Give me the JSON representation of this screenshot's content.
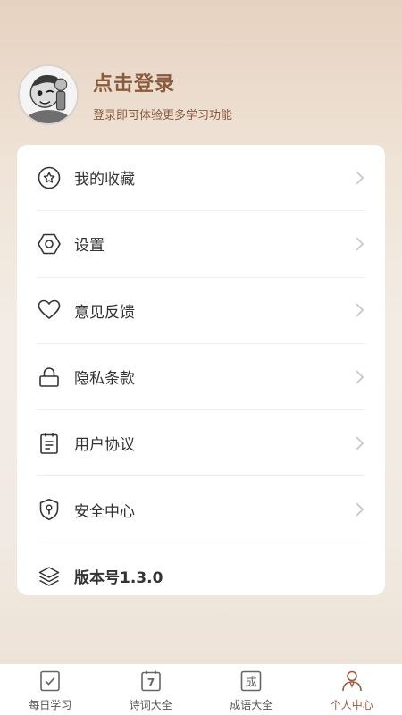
{
  "profile": {
    "title": "点击登录",
    "subtitle": "登录即可体验更多学习功能"
  },
  "menu": [
    {
      "label": "我的收藏",
      "icon": "star-circle-icon"
    },
    {
      "label": "设置",
      "icon": "hexagon-settings-icon"
    },
    {
      "label": "意见反馈",
      "icon": "heart-icon"
    },
    {
      "label": "隐私条款",
      "icon": "lock-icon"
    },
    {
      "label": "用户协议",
      "icon": "document-icon"
    },
    {
      "label": "安全中心",
      "icon": "shield-icon"
    },
    {
      "label": "版本号1.3.0",
      "icon": "layers-icon"
    }
  ],
  "tabs": [
    {
      "label": "每日学习",
      "icon": "check-calendar-icon"
    },
    {
      "label": "诗词大全",
      "icon": "calendar-seven-icon",
      "glyph": "7"
    },
    {
      "label": "成语大全",
      "icon": "idiom-icon",
      "glyph": "成"
    },
    {
      "label": "个人中心",
      "icon": "person-icon",
      "active": true
    }
  ],
  "colors": {
    "accent": "#8a5a3c",
    "active_tab": "#9a5a3a"
  }
}
